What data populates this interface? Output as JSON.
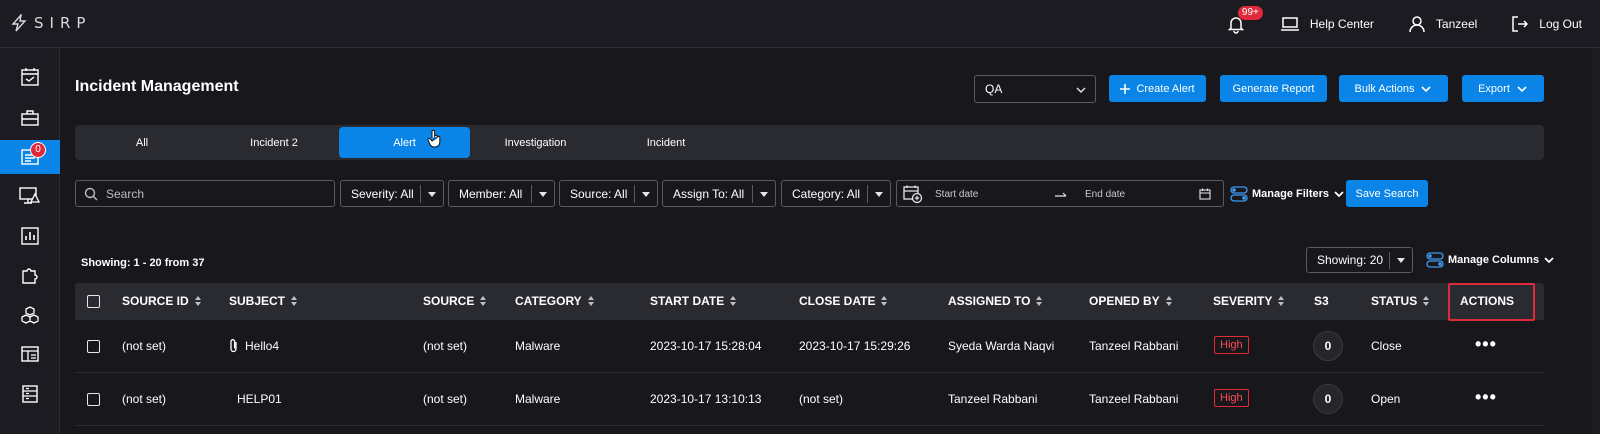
{
  "app": {
    "logo_text": "SIRP"
  },
  "header": {
    "notifications_badge": "99+",
    "help_center": "Help Center",
    "user_name": "Tanzeel",
    "logout": "Log Out"
  },
  "sidebar": {
    "items": [
      {
        "icon": "calendar-check-icon",
        "active": false
      },
      {
        "icon": "briefcase-icon",
        "active": false
      },
      {
        "icon": "incident-list-icon",
        "active": true,
        "badge": "0"
      },
      {
        "icon": "monitor-alert-icon",
        "active": false
      },
      {
        "icon": "chart-bars-icon",
        "active": false
      },
      {
        "icon": "puzzle-icon",
        "active": false
      },
      {
        "icon": "cubes-icon",
        "active": false
      },
      {
        "icon": "dashboard-icon",
        "active": false
      },
      {
        "icon": "server-icon",
        "active": false
      }
    ]
  },
  "page": {
    "title": "Incident Management",
    "workspace_select": "QA",
    "buttons": {
      "create_alert": "Create Alert",
      "generate_report": "Generate Report",
      "bulk_actions": "Bulk Actions",
      "export": "Export"
    }
  },
  "tabs": [
    {
      "label": "All",
      "active": false
    },
    {
      "label": "Incident 2",
      "active": false
    },
    {
      "label": "Alert",
      "active": true
    },
    {
      "label": "Investigation",
      "active": false
    },
    {
      "label": "Incident",
      "active": false
    }
  ],
  "filters": {
    "search_placeholder": "Search",
    "severity": "Severity: All",
    "member": "Member: All",
    "source": "Source: All",
    "assign_to": "Assign To: All",
    "category": "Category: All",
    "start_date": "Start date",
    "end_date": "End date",
    "manage_filters": "Manage Filters",
    "save_search": "Save Search"
  },
  "list": {
    "showing_text": "Showing: 1 - 20 from 37",
    "page_size": "Showing: 20",
    "manage_columns": "Manage Columns"
  },
  "table": {
    "headers": [
      "SOURCE ID",
      "SUBJECT",
      "SOURCE",
      "CATEGORY",
      "START DATE",
      "CLOSE DATE",
      "ASSIGNED TO",
      "OPENED BY",
      "SEVERITY",
      "S3",
      "STATUS",
      "ACTIONS"
    ],
    "rows": [
      {
        "source_id": "(not set)",
        "subject": "Hello4",
        "has_attachment": true,
        "source": "(not set)",
        "category": "Malware",
        "start_date": "2023-10-17 15:28:04",
        "close_date": "2023-10-17 15:29:26",
        "assigned_to": "Syeda Warda Naqvi",
        "opened_by": "Tanzeel Rabbani",
        "severity": "High",
        "s3": "0",
        "status": "Close",
        "actions": "•••"
      },
      {
        "source_id": "(not set)",
        "subject": "HELP01",
        "has_attachment": false,
        "source": "(not set)",
        "category": "Malware",
        "start_date": "2023-10-17 13:10:13",
        "close_date": "(not set)",
        "assigned_to": "Tanzeel Rabbani",
        "opened_by": "Tanzeel Rabbani",
        "severity": "High",
        "s3": "0",
        "status": "Open",
        "actions": "•••"
      }
    ]
  },
  "colors": {
    "accent": "#0a84e6",
    "danger": "#e02a3b",
    "background": "#17171c",
    "panel": "#2a2a31"
  }
}
